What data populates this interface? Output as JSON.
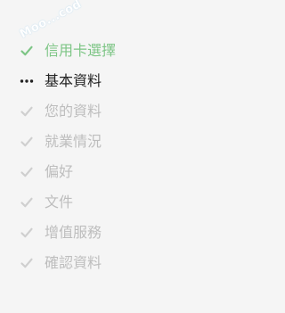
{
  "watermark": {
    "text": "Moo...cod"
  },
  "steps": [
    {
      "label": "信用卡選擇",
      "state": "done",
      "icon": "check-icon"
    },
    {
      "label": "基本資料",
      "state": "current",
      "icon": "more-dots-icon"
    },
    {
      "label": "您的資料",
      "state": "pending",
      "icon": "check-icon"
    },
    {
      "label": "就業情況",
      "state": "pending",
      "icon": "check-icon"
    },
    {
      "label": "偏好",
      "state": "pending",
      "icon": "check-icon"
    },
    {
      "label": "文件",
      "state": "pending",
      "icon": "check-icon"
    },
    {
      "label": "增值服務",
      "state": "pending",
      "icon": "check-icon"
    },
    {
      "label": "確認資料",
      "state": "pending",
      "icon": "check-icon"
    }
  ],
  "colors": {
    "background": "#f5f5f5",
    "done": "#7dc585",
    "current": "#222222",
    "pending": "#bdbdbd"
  }
}
